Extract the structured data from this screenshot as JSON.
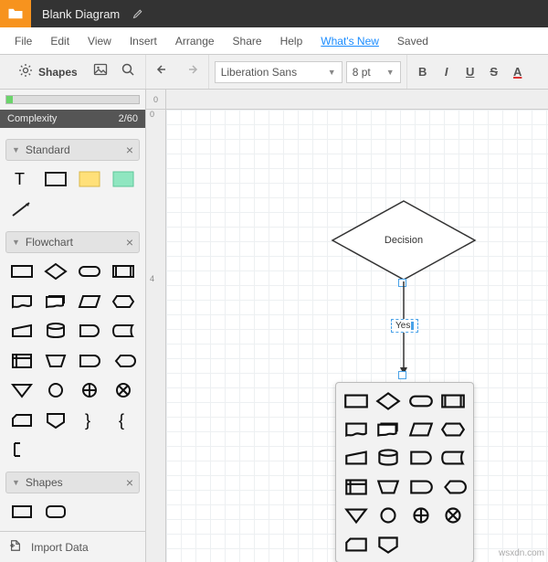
{
  "title": "Blank Diagram",
  "menu": [
    "File",
    "Edit",
    "View",
    "Insert",
    "Arrange",
    "Share",
    "Help"
  ],
  "menuLink": "What's New",
  "menuSaved": "Saved",
  "toolbar": {
    "shapes": "Shapes"
  },
  "font": {
    "name": "Liberation Sans",
    "size": "8 pt"
  },
  "format": {
    "b": "B",
    "i": "I",
    "u": "U",
    "s": "S",
    "a": "A"
  },
  "complexity": {
    "label": "Complexity",
    "value": "2/60"
  },
  "categories": {
    "standard": "Standard",
    "flowchart": "Flowchart",
    "shapes": "Shapes"
  },
  "import": "Import Data",
  "decision": "Decision",
  "connLabel": "Yes",
  "ruler": {
    "h0": "0",
    "v0": "0",
    "v4": "4"
  },
  "watermark": "wsxdn.com"
}
